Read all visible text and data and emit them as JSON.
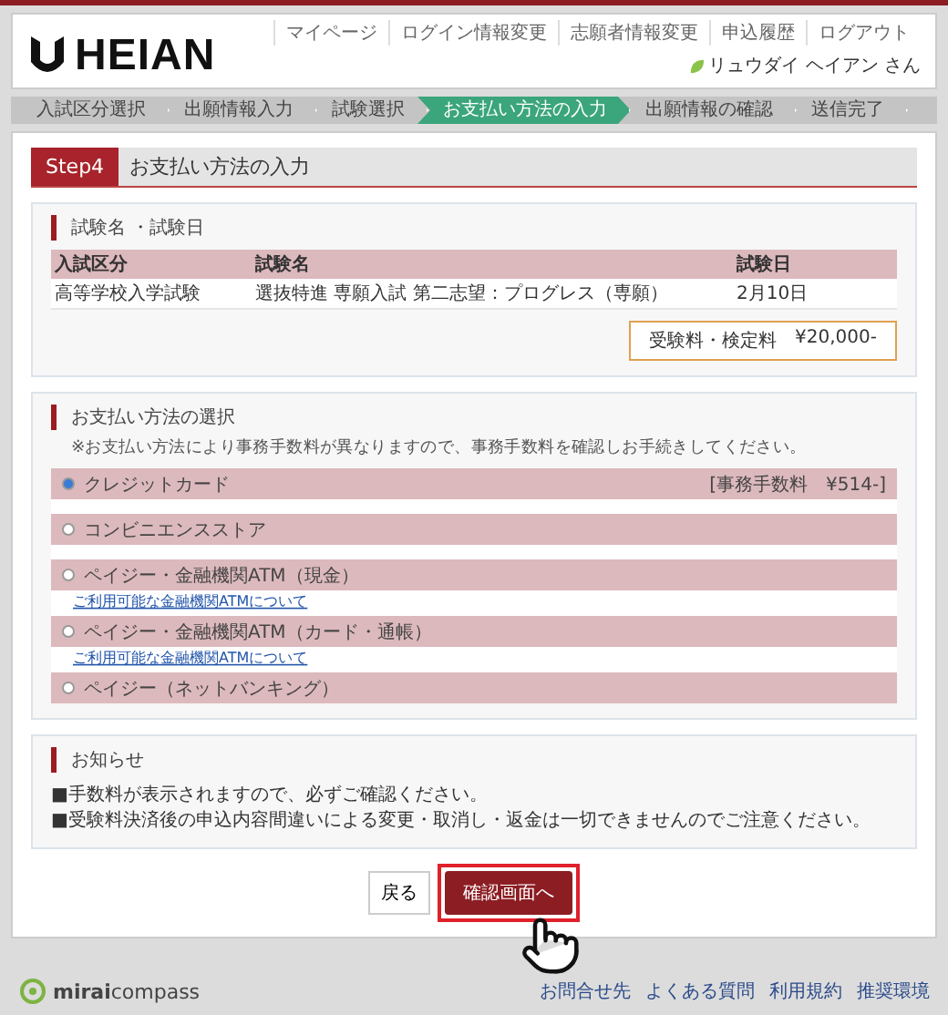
{
  "header": {
    "logo": "HEIAN",
    "nav": [
      "マイページ",
      "ログイン情報変更",
      "志願者情報変更",
      "申込履歴",
      "ログアウト"
    ],
    "user": "リュウダイ ヘイアン さん"
  },
  "steps": [
    {
      "label": "入試区分選択",
      "selected": false
    },
    {
      "label": "出願情報入力",
      "selected": false
    },
    {
      "label": "試験選択",
      "selected": false
    },
    {
      "label": "お支払い方法の入力",
      "selected": true
    },
    {
      "label": "出願情報の確認",
      "selected": false
    },
    {
      "label": "送信完了",
      "selected": false
    }
  ],
  "page_title": {
    "badge": "Step4",
    "title": "お支払い方法の入力"
  },
  "exam": {
    "heading": "試験名 ・試験日",
    "columns": [
      "入試区分",
      "試験名",
      "試験日"
    ],
    "rows": [
      [
        "高等学校入学試験",
        "選抜特進 専願入試 第二志望：プログレス（専願）",
        "2月10日"
      ]
    ],
    "fee_label": "受験料・検定料",
    "fee_amount": "¥20,000-"
  },
  "payment": {
    "heading": "お支払い方法の選択",
    "note": "※お支払い方法により事務手数料が異なりますので、事務手数料を確認しお手続きしてください。",
    "methods": [
      {
        "label": "クレジットカード",
        "selected": true,
        "fee": "[事務手数料　¥514-]"
      },
      {
        "label": "コンビニエンスストア",
        "selected": false
      },
      {
        "label": "ペイジー・金融機関ATM（現金）",
        "selected": false,
        "link": "ご利用可能な金融機関ATMについて"
      },
      {
        "label": "ペイジー・金融機関ATM（カード・通帳）",
        "selected": false,
        "link": "ご利用可能な金融機関ATMについて"
      },
      {
        "label": "ペイジー（ネットバンキング）",
        "selected": false
      }
    ]
  },
  "notice": {
    "heading": "お知らせ",
    "lines": [
      "■手数料が表示されますので、必ずご確認ください。",
      "■受験料決済後の申込内容間違いによる変更・取消し・返金は一切できませんのでご注意ください。"
    ]
  },
  "buttons": {
    "back": "戻る",
    "next": "確認画面へ"
  },
  "footer": {
    "brand": "**mirai**compass",
    "links": [
      "お問合せ先",
      "よくある質問",
      "利用規約",
      "推奨環境"
    ]
  }
}
